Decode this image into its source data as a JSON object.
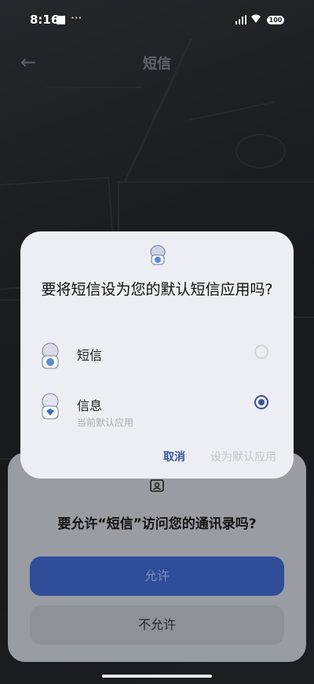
{
  "status": {
    "time": "8:16",
    "more": "···",
    "battery": "100"
  },
  "appbar": {
    "title": "短信"
  },
  "dialog": {
    "title": "要将短信设为您的默认短信应用吗?",
    "options": [
      {
        "name": "短信",
        "subtitle": "",
        "selected": false
      },
      {
        "name": "信息",
        "subtitle": "当前默认应用",
        "selected": true
      }
    ],
    "cancel_label": "取消",
    "confirm_label": "设为默认应用"
  },
  "permission": {
    "question": "要允许“短信”访问您的通讯录吗?",
    "allow_label": "允许",
    "deny_label": "不允许"
  },
  "colors": {
    "accent": "#3d5393",
    "allow_button": "#2f4d98"
  },
  "icons": [
    "contacts-icon",
    "back-arrow-icon",
    "signal-icon",
    "wifi-icon",
    "battery-icon",
    "app-avatar-icon"
  ]
}
